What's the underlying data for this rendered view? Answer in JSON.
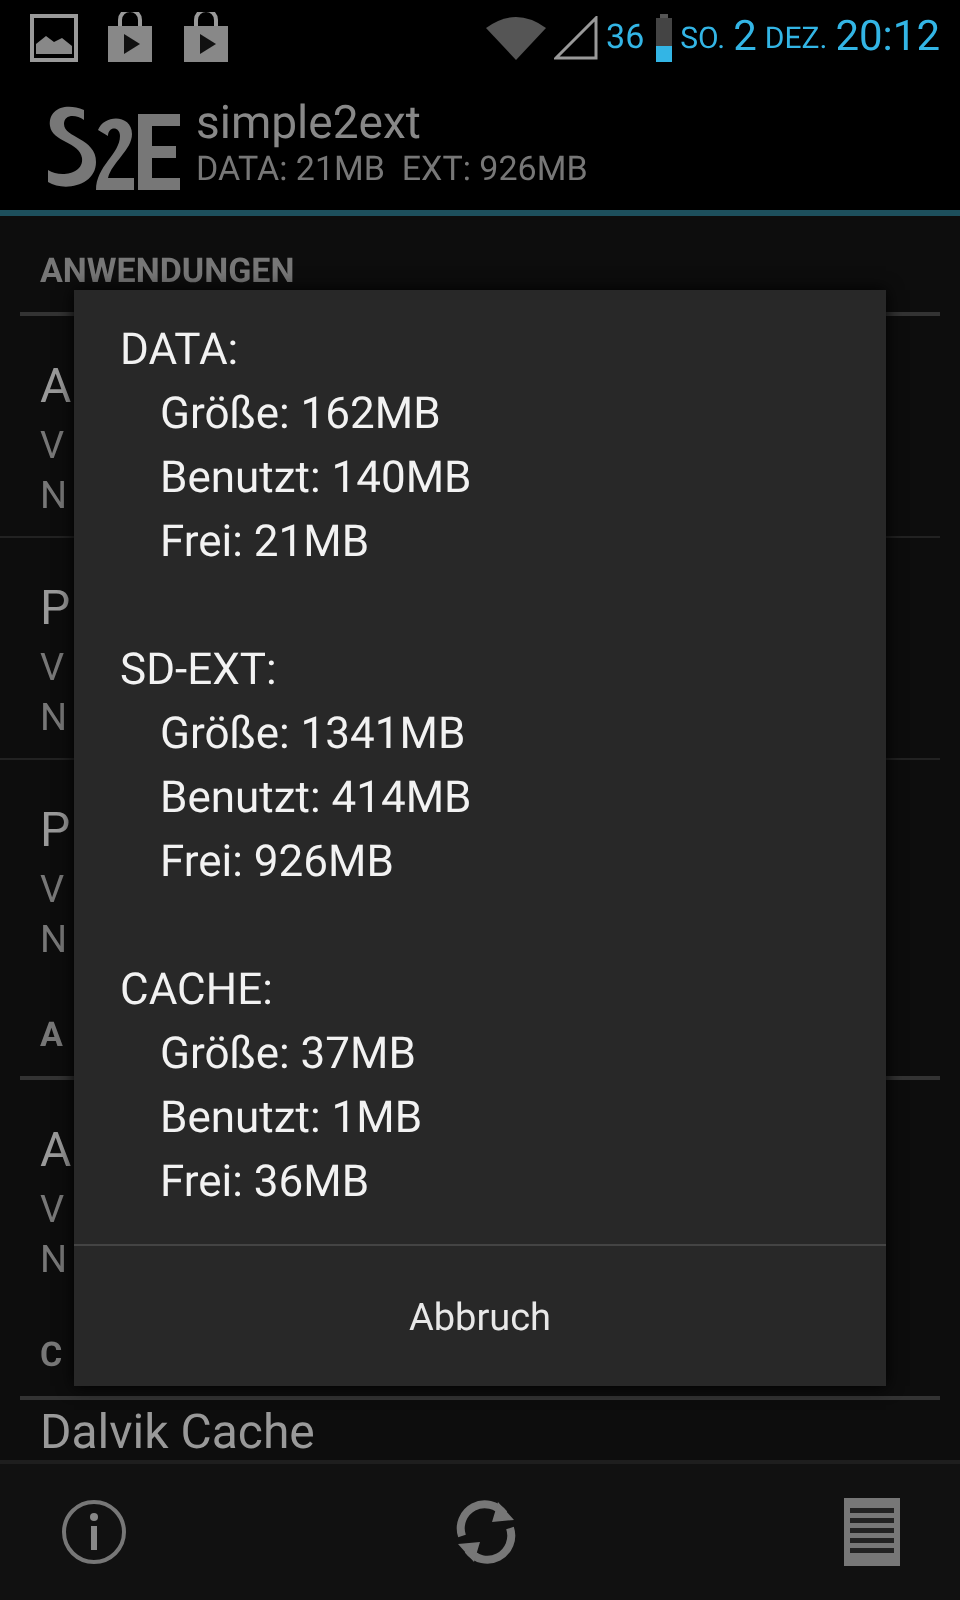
{
  "status_bar": {
    "battery_percent": "36",
    "weekday": "SO.",
    "day": "2",
    "month": "DEZ.",
    "time": "20:12"
  },
  "app_header": {
    "title": "simple2ext",
    "subtitle": "DATA: 21MB  EXT: 926MB"
  },
  "list": {
    "sections": [
      {
        "title": "ANWENDUNGEN",
        "items": [
          {
            "lines": [
              "A",
              "V",
              "N"
            ]
          },
          {
            "lines": [
              "P",
              "V",
              "N"
            ]
          },
          {
            "lines": [
              "P",
              "V",
              "N"
            ]
          }
        ]
      },
      {
        "title": "A",
        "items": [
          {
            "lines": [
              "A",
              "V",
              "N"
            ]
          }
        ]
      },
      {
        "title": "C",
        "items": [
          {
            "lines": [
              "Dalvik Cache"
            ]
          }
        ]
      }
    ]
  },
  "dialog": {
    "sections": [
      {
        "title": "DATA:",
        "rows": [
          "Größe: 162MB",
          "Benutzt: 140MB",
          "Frei: 21MB"
        ]
      },
      {
        "title": "SD-EXT:",
        "rows": [
          "Größe: 1341MB",
          "Benutzt: 414MB",
          "Frei: 926MB"
        ]
      },
      {
        "title": "CACHE:",
        "rows": [
          "Größe: 37MB",
          "Benutzt: 1MB",
          "Frei: 36MB"
        ]
      }
    ],
    "button": "Abbruch"
  }
}
